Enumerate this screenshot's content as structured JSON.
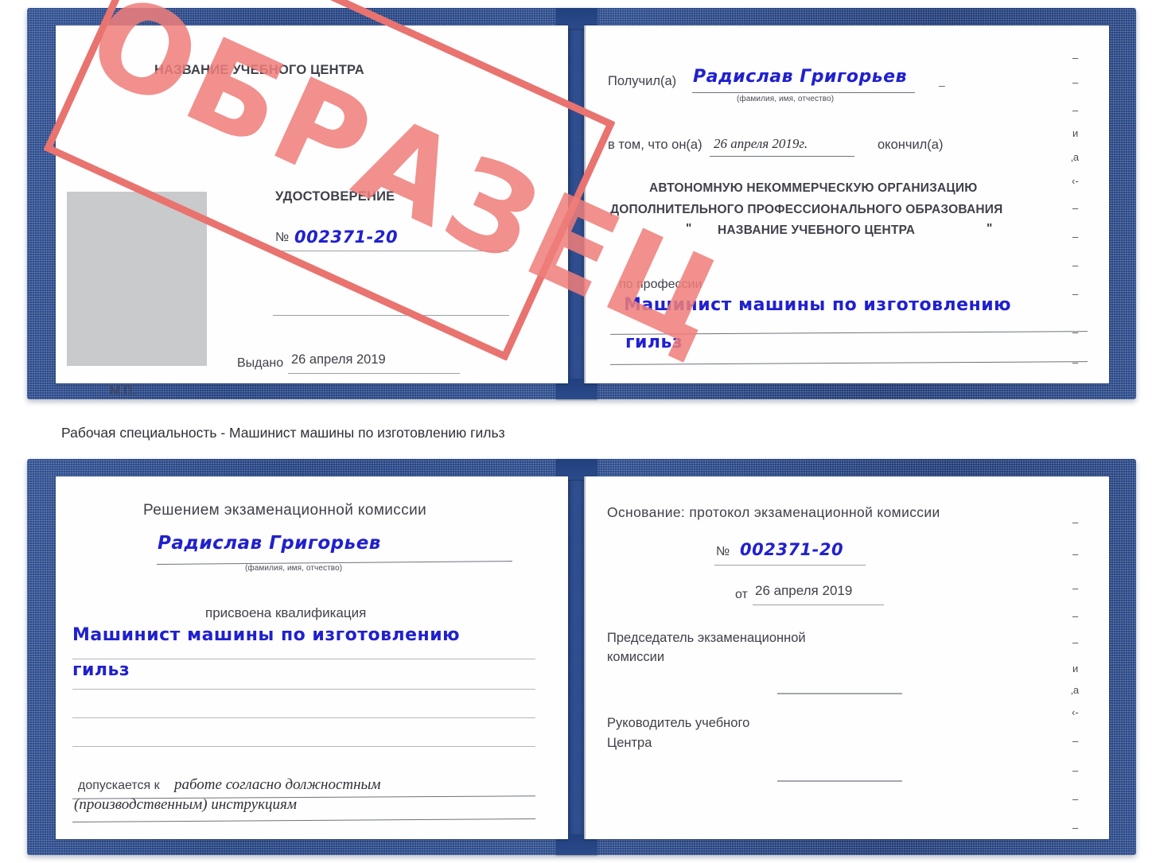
{
  "document": {
    "kind": "certificate-scan",
    "caption": "Рабочая специальность - Машинист машины по изготовлению гильз",
    "colors": {
      "cover_blue": "#2c4c8d",
      "stamp_red": "#ef7e7b",
      "handwriting_blue": "#2020cf",
      "photo_placeholder_gray": "#c9cacc"
    }
  },
  "watermark": {
    "text": "ОБРАЗЕЦ",
    "meaning": "SAMPLE"
  },
  "certificate_top": {
    "left_page": {
      "center_name": "НАЗВАНИЕ УЧЕБНОГО ЦЕНТРА",
      "title": "УДОСТОВЕРЕНИЕ",
      "number_label": "№",
      "number_value": "002371-20",
      "issued_label": "Выдано",
      "issued_value": "26 апреля 2019",
      "seal_label": "М.П.",
      "photo_placeholder": ""
    },
    "right_page": {
      "received_label": "Получил(а)",
      "received_value": "Радислав Григорьев",
      "name_hint": "(фамилия, имя, отчество)",
      "in_that_label": "в том, что он(а)",
      "completion_date": "26 апреля 2019г.",
      "finished_label": "окончил(а)",
      "org_line1": "АВТОНОМНУЮ НЕКОММЕРЧЕСКУЮ ОРГАНИЗАЦИЮ",
      "org_line2": "ДОПОЛНИТЕЛЬНОГО ПРОФЕССИОНАЛЬНОГО ОБРАЗОВАНИЯ",
      "org_quote_open": "\"",
      "org_line3": "НАЗВАНИЕ УЧЕБНОГО ЦЕНТРА",
      "org_quote_close": "\"",
      "profession_label": "по профессии",
      "profession_value_line1": "Машинист машины по изготовлению",
      "profession_value_line2": "гильз",
      "edge_fragments": [
        "–",
        "–",
        "–",
        "и",
        "‚а",
        "‹-",
        "–",
        "–",
        "–"
      ]
    }
  },
  "certificate_bottom": {
    "left_page": {
      "heading": "Решением экзаменационной комиссии",
      "name_value": "Радислав Григорьев",
      "name_hint": "(фамилия, имя, отчество)",
      "qualification_label": "присвоена квалификация",
      "qualification_line1": "Машинист машины по изготовлению",
      "qualification_line2": "гильз",
      "allowed_label": "допускается к",
      "allowed_value_line1": "работе согласно должностным",
      "allowed_value_line2": "(производственным) инструкциям"
    },
    "right_page": {
      "basis_label": "Основание: протокол экзаменационной комиссии",
      "number_label": "№",
      "number_value": "002371-20",
      "from_label": "от",
      "from_value": "26 апреля 2019",
      "chairman_line1": "Председатель экзаменационной",
      "chairman_line2": "комиссии",
      "head_line1": "Руководитель учебного",
      "head_line2": "Центра",
      "edge_fragments": [
        "–",
        "–",
        "–",
        "и",
        "‚а",
        "‹-",
        "–",
        "–",
        "–",
        "–"
      ]
    }
  }
}
